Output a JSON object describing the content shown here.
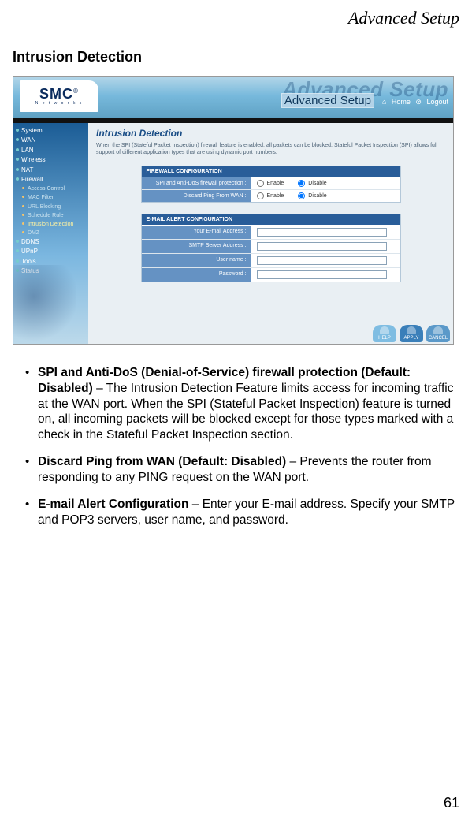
{
  "header_title": "Advanced Setup",
  "section_heading": "Intrusion Detection",
  "page_number": "61",
  "screenshot": {
    "brand": "SMC",
    "brand_sub": "N e t w o r k s",
    "brand_reg": "®",
    "watermark": "Advanced Setup",
    "bar_label": "Advanced Setup",
    "top_link_home": "Home",
    "top_link_logout": "Logout",
    "top_link_home_icon": "⌂",
    "top_link_logout_icon": "⊘",
    "sidebar": [
      {
        "label": "System",
        "type": "parent"
      },
      {
        "label": "WAN",
        "type": "parent"
      },
      {
        "label": "LAN",
        "type": "parent"
      },
      {
        "label": "Wireless",
        "type": "parent"
      },
      {
        "label": "NAT",
        "type": "parent"
      },
      {
        "label": "Firewall",
        "type": "parent"
      },
      {
        "label": "Access Control",
        "type": "sub"
      },
      {
        "label": "MAC Filter",
        "type": "sub"
      },
      {
        "label": "URL Blocking",
        "type": "sub"
      },
      {
        "label": "Schedule Rule",
        "type": "sub"
      },
      {
        "label": "Intrusion Detection",
        "type": "sub",
        "active": true
      },
      {
        "label": "DMZ",
        "type": "sub"
      },
      {
        "label": "DDNS",
        "type": "parent"
      },
      {
        "label": "UPnP",
        "type": "parent"
      },
      {
        "label": "Tools",
        "type": "parent"
      },
      {
        "label": "Status",
        "type": "parent"
      }
    ],
    "panel_title": "Intrusion Detection",
    "panel_desc": "When the SPI (Stateful Packet Inspection) firewall feature is enabled, all packets can be blocked. Stateful Packet Inspection (SPI) allows full support of different application types that are using dynamic port numbers.",
    "firewall_header": "FIREWALL CONFIGURATION",
    "spi_label": "SPI and Anti-DoS firewall protection :",
    "discard_label": "Discard Ping From WAN :",
    "opt_enable": "Enable",
    "opt_disable": "Disable",
    "email_header": "E-MAIL ALERT CONFIGURATION",
    "email_addr_label": "Your E-mail Address :",
    "smtp_label": "SMTP Server Address :",
    "user_label": "User name :",
    "pass_label": "Password :",
    "btn_help": "HELP",
    "btn_apply": "APPLY",
    "btn_cancel": "CANCEL"
  },
  "bullets": [
    {
      "lead": "SPI and Anti-DoS (Denial-of-Service) firewall protection (Default: Disabled)",
      "rest": " – The Intrusion Detection Feature limits access for incoming traffic at the WAN port. When the SPI (Stateful Packet Inspection) feature is turned on, all incoming packets will be blocked except for those types marked with a check in the Stateful Packet Inspection section."
    },
    {
      "lead": "Discard Ping from WAN (Default: Disabled)",
      "rest": " – Prevents the router from responding to any PING request on the WAN port."
    },
    {
      "lead": "E-mail Alert Configuration",
      "rest": " – Enter your E-mail address. Specify your SMTP and POP3 servers, user name, and password."
    }
  ]
}
